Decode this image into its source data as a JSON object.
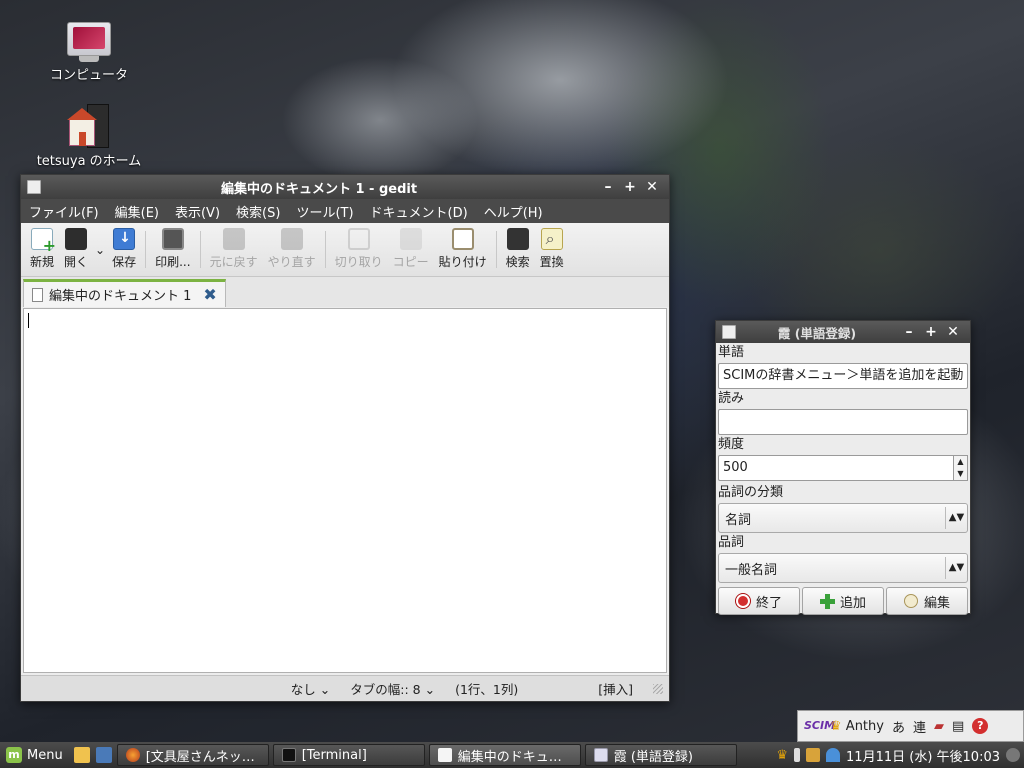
{
  "desktop": {
    "icons": [
      {
        "label": "コンピュータ"
      },
      {
        "label": "tetsuya のホーム"
      }
    ]
  },
  "gedit": {
    "title": "編集中のドキュメント 1 - gedit",
    "menu": [
      "ファイル(F)",
      "編集(E)",
      "表示(V)",
      "検索(S)",
      "ツール(T)",
      "ドキュメント(D)",
      "ヘルプ(H)"
    ],
    "toolbar": {
      "new": "新規",
      "open": "開く",
      "save": "保存",
      "print": "印刷...",
      "undo": "元に戻す",
      "redo": "やり直す",
      "cut": "切り取り",
      "copy": "コピー",
      "paste": "貼り付け",
      "find": "検索",
      "replace": "置換"
    },
    "tab_label": "編集中のドキュメント 1",
    "status": {
      "highlight": "なし",
      "tab_width": "タブの幅:: 8",
      "position": "(1行、1列)",
      "mode": "[挿入]"
    }
  },
  "dialog": {
    "title": "霞 (単語登録)",
    "word_label": "単語",
    "word_value": "SCIMの辞書メニュー＞単語を追加を起動",
    "reading_label": "読み",
    "reading_value": "",
    "freq_label": "頻度",
    "freq_value": "500",
    "pos_category_label": "品詞の分類",
    "pos_category_value": "名詞",
    "pos_label": "品詞",
    "pos_value": "一般名詞",
    "buttons": {
      "quit": "終了",
      "add": "追加",
      "edit": "編集"
    }
  },
  "scim": {
    "logo": "SCIM",
    "engine": "Anthy",
    "mode": "あ",
    "conv": "連"
  },
  "taskbar": {
    "menu_label": "Menu",
    "tasks": [
      "[文具屋さんネッ…",
      "[Terminal]",
      "編集中のドキュ…",
      "霞 (単語登録)"
    ],
    "clock": "11月11日 (水) 午後10:03"
  },
  "colors": {
    "accent_tab": "#7cb342",
    "titlebar": "#444444",
    "quit_red": "#d32f2f",
    "add_green": "#3aa13a"
  }
}
